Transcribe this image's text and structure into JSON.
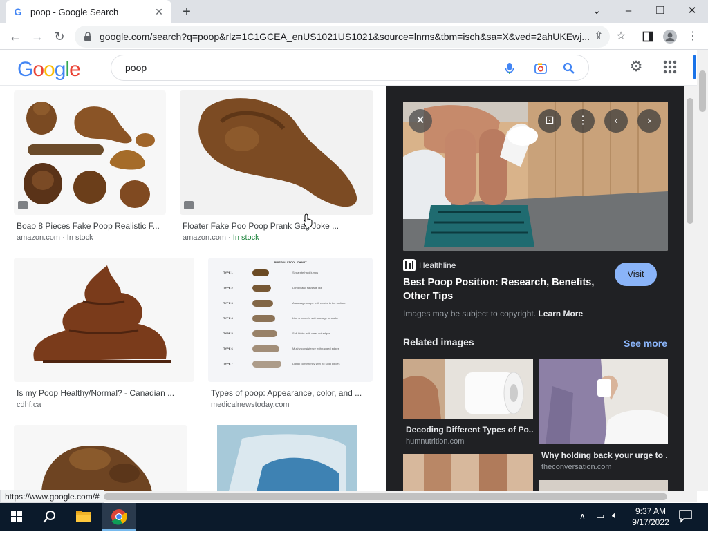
{
  "browser": {
    "tab_title": "poop - Google Search",
    "url": "google.com/search?q=poop&rlz=1C1GCEA_enUS1021US1021&source=lnms&tbm=isch&sa=X&ved=2ahUKEwj...",
    "status_url": "https://www.google.com/#"
  },
  "google": {
    "logo": "Google",
    "query": "poop"
  },
  "results": [
    {
      "caption": "Boao 8 Pieces Fake Poop Realistic F...",
      "source": "amazon.com",
      "stock": "In stock"
    },
    {
      "caption": "Floater Fake Poo Poop Prank Gag Joke ...",
      "source": "amazon.com",
      "stock": "In stock"
    },
    {
      "caption": "Is my Poop Healthy/Normal? - Canadian ...",
      "source": "cdhf.ca",
      "stock": ""
    },
    {
      "caption": "Types of poop: Appearance, color, and ...",
      "source": "medicalnewstoday.com",
      "stock": ""
    }
  ],
  "stock_sep": " · ",
  "chart_mini": {
    "title": "BRISTOL STOOL CHART",
    "types": [
      "TYPE 1",
      "TYPE 2",
      "TYPE 3",
      "TYPE 4",
      "TYPE 5",
      "TYPE 6",
      "TYPE 7"
    ],
    "descs": [
      "Separate hard lumps",
      "Lumpy and sausage like",
      "A sausage shape with cracks in the surface",
      "Like a smooth, soft sausage or snake",
      "Soft blobs with clear-cut edges",
      "Mushy consistency with ragged edges",
      "Liquid consistency with no solid pieces"
    ]
  },
  "panel": {
    "source_name": "Healthline",
    "title": "Best Poop Position: Research, Benefits, Other Tips",
    "visit": "Visit",
    "copyright": "Images may be subject to copyright.",
    "learn_more": "Learn More",
    "related_heading": "Related images",
    "see_more": "See more",
    "related": [
      {
        "caption": "Decoding Different Types of Po...",
        "source": "humnutrition.com"
      },
      {
        "caption": "Why holding back your urge to ...",
        "source": "theconversation.com"
      }
    ]
  },
  "taskbar": {
    "time": "9:37 AM",
    "date": "9/17/2022"
  },
  "colors": {
    "accent": "#1a73e8",
    "panel_bg": "#202124",
    "visit_btn": "#8ab4f8",
    "in_stock": "#188038",
    "taskbar": "#0b1a2b"
  }
}
